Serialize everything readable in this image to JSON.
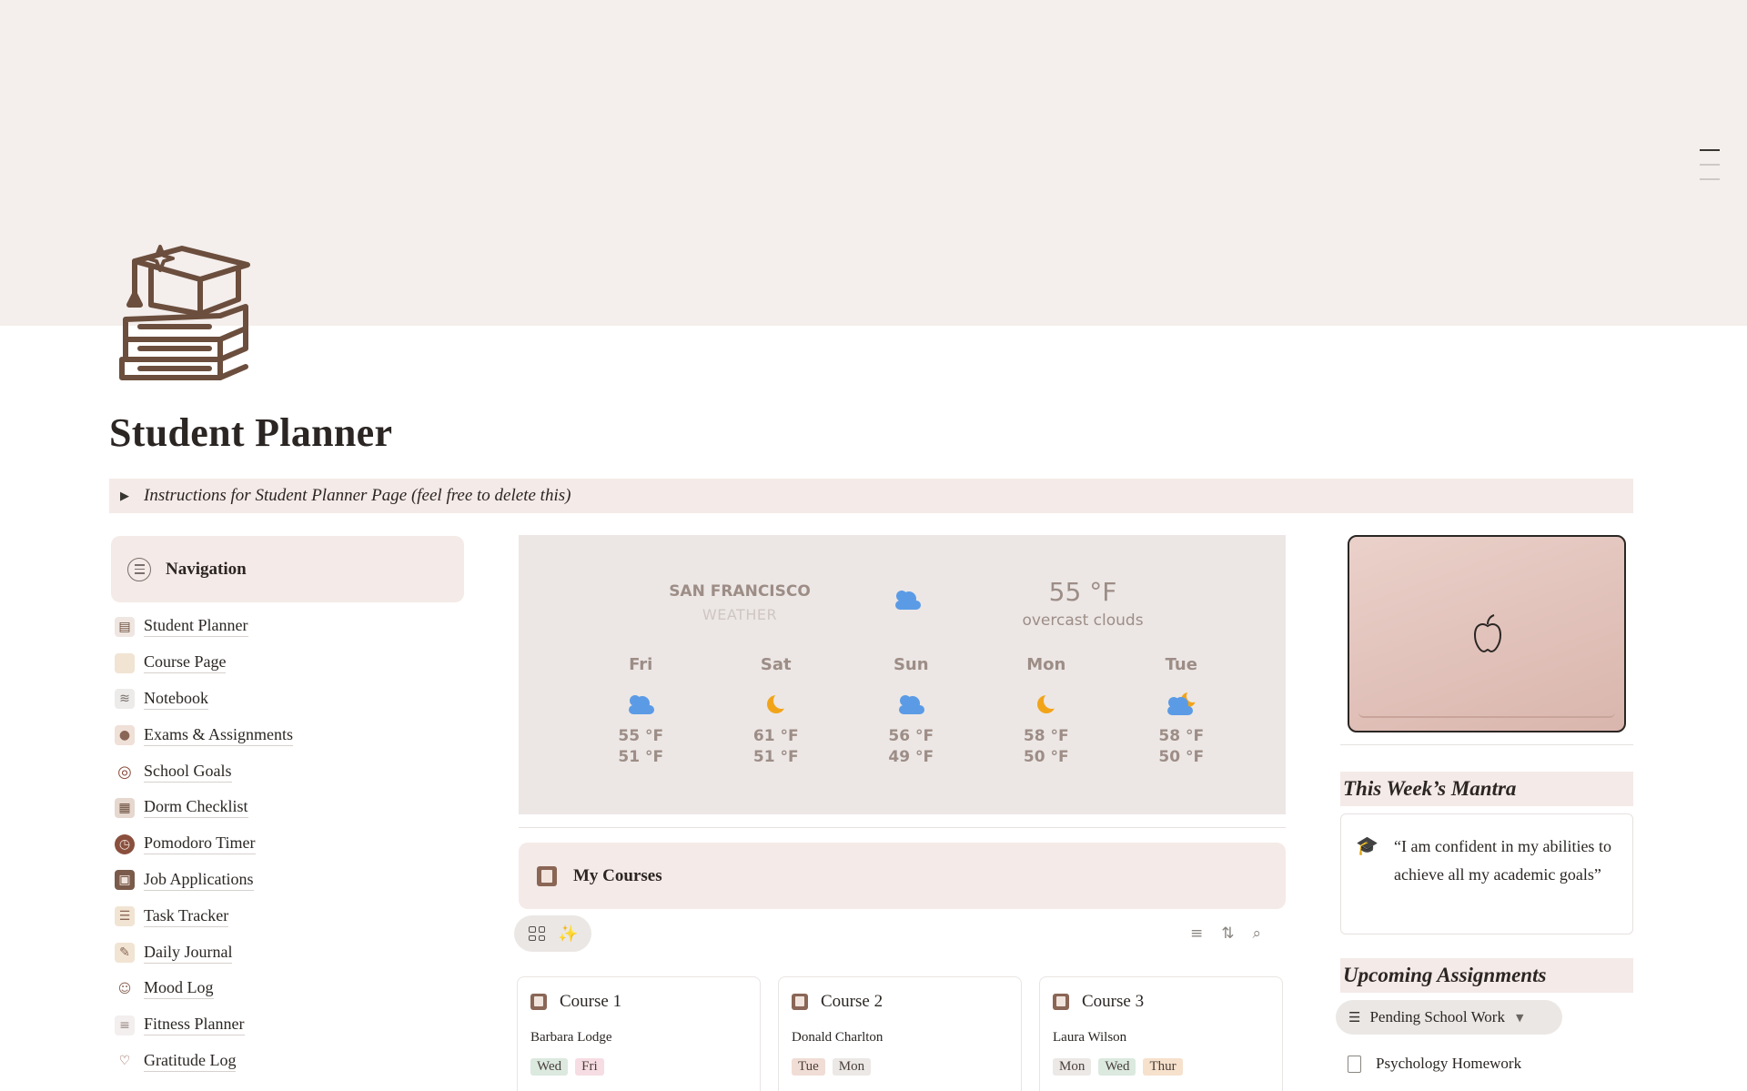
{
  "page": {
    "title": "Student Planner",
    "icon": "graduation-cap-books-icon",
    "toggle_label": "Instructions for Student Planner Page (feel free to delete this)"
  },
  "navigation": {
    "header": "Navigation",
    "items": [
      {
        "label": "Student Planner",
        "icon": "books-icon"
      },
      {
        "label": "Course Page",
        "icon": "paper-icon"
      },
      {
        "label": "Notebook",
        "icon": "notebook-icon"
      },
      {
        "label": "Exams & Assignments",
        "icon": "student-icon"
      },
      {
        "label": "School Goals",
        "icon": "target-icon"
      },
      {
        "label": "Dorm Checklist",
        "icon": "building-icon"
      },
      {
        "label": "Pomodoro Timer",
        "icon": "alarm-clock-icon"
      },
      {
        "label": "Job Applications",
        "icon": "id-card-icon"
      },
      {
        "label": "Task Tracker",
        "icon": "checklist-icon"
      },
      {
        "label": "Daily Journal",
        "icon": "journal-icon"
      },
      {
        "label": "Mood Log",
        "icon": "mood-icon"
      },
      {
        "label": "Fitness Planner",
        "icon": "clipboard-icon"
      },
      {
        "label": "Gratitude Log",
        "icon": "hands-heart-icon"
      }
    ]
  },
  "weather": {
    "city": "SAN FRANCISCO",
    "subtitle": "WEATHER",
    "current_temp": "55 °F",
    "current_desc": "overcast clouds",
    "current_icon": "cloud-icon",
    "forecast": [
      {
        "day": "Fri",
        "icon": "cloud-icon",
        "high": "55 °F",
        "low": "51 °F"
      },
      {
        "day": "Sat",
        "icon": "moon-icon",
        "high": "61 °F",
        "low": "51 °F"
      },
      {
        "day": "Sun",
        "icon": "cloud-icon",
        "high": "56 °F",
        "low": "49 °F"
      },
      {
        "day": "Mon",
        "icon": "moon-icon",
        "high": "58 °F",
        "low": "50 °F"
      },
      {
        "day": "Tue",
        "icon": "cloud-moon-icon",
        "high": "58 °F",
        "low": "50 °F"
      }
    ]
  },
  "courses": {
    "header": "My Courses",
    "items": [
      {
        "name": "Course 1",
        "teacher": "Barbara Lodge",
        "days": [
          {
            "label": "Wed",
            "color": "#dbe9df"
          },
          {
            "label": "Fri",
            "color": "#f6dde3"
          }
        ]
      },
      {
        "name": "Course 2",
        "teacher": "Donald Charlton",
        "days": [
          {
            "label": "Tue",
            "color": "#f0ddd5"
          },
          {
            "label": "Mon",
            "color": "#ebe8e6"
          }
        ]
      },
      {
        "name": "Course 3",
        "teacher": "Laura Wilson",
        "days": [
          {
            "label": "Mon",
            "color": "#ebe8e6"
          },
          {
            "label": "Wed",
            "color": "#dbe9df"
          },
          {
            "label": "Thur",
            "color": "#f6e1cc"
          }
        ]
      }
    ]
  },
  "mantra": {
    "header": "This Week’s Mantra",
    "quote": "“I am confident in my abilities to achieve all my academic goals”"
  },
  "assignments": {
    "header": "Upcoming Assignments",
    "view_label": "Pending School Work",
    "items": [
      "Psychology Homework"
    ]
  },
  "colors": {
    "cover": "#f4eeec",
    "accent_block": "#f4eae7",
    "weather_bg": "#ece7e5",
    "weather_text": "#9d8d86",
    "cloud_blue": "#5b9be6",
    "moon_orange": "#f2a419"
  }
}
